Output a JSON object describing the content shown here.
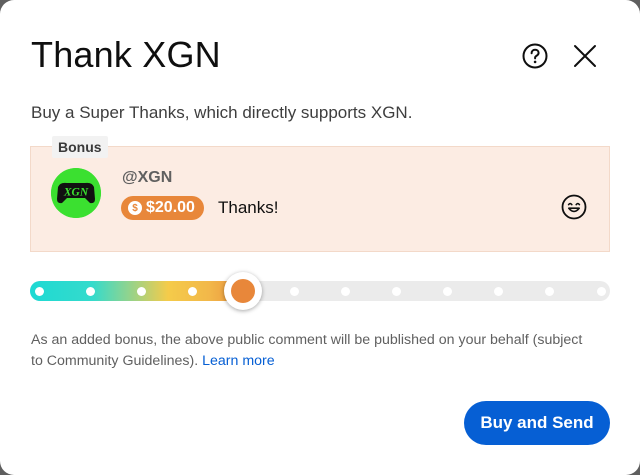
{
  "dialog": {
    "title": "Thank XGN",
    "subtitle": "Buy a Super Thanks, which directly supports XGN.",
    "help_icon": "help-circle-icon",
    "close_icon": "close-icon"
  },
  "preview": {
    "bonus_label": "Bonus",
    "avatar_text": "XGN",
    "handle": "@XGN",
    "amount": "$20.00",
    "coin_symbol": "$",
    "comment": "Thanks!",
    "emoji_icon": "smile-emoji-icon",
    "background_color": "#fcece3",
    "accent_color": "#e8873a"
  },
  "slider": {
    "steps": 12,
    "selected_index": 4,
    "selected_fraction": 0.37,
    "colors": [
      "#1ed9d3",
      "#f5cb4a",
      "#e8873a"
    ]
  },
  "disclaimer": {
    "text": "As an added bonus, the above public comment will be published on your behalf (subject to Community Guidelines).",
    "link": "Learn more"
  },
  "actions": {
    "buy_label": "Buy and Send",
    "buy_color": "#065fd4"
  }
}
